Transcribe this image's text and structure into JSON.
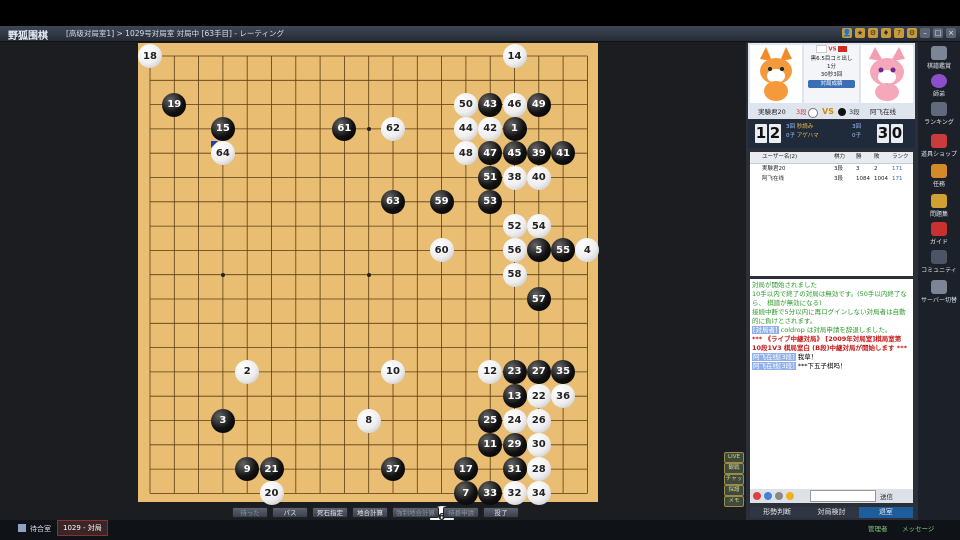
{
  "title": {
    "app": "野狐围棋",
    "breadcrumb": "[高级对局室1] > 1029号对局室  対局中 [63手目] - レーティング"
  },
  "title_icons": [
    "user-icon",
    "medal-icon",
    "gear-icon",
    "shirt-icon",
    "help-icon",
    "settings-icon",
    "minimize-icon",
    "maximize-icon",
    "close-icon"
  ],
  "board": {
    "size": 19,
    "last_move": 63,
    "black_stones": [
      {
        "col": 2,
        "row": 3,
        "n": "19"
      },
      {
        "col": 4,
        "row": 4,
        "n": "15"
      },
      {
        "col": 9,
        "row": 4,
        "n": "61"
      },
      {
        "col": 15,
        "row": 3,
        "n": "43"
      },
      {
        "col": 17,
        "row": 3,
        "n": "49"
      },
      {
        "col": 16,
        "row": 4,
        "n": "1"
      },
      {
        "col": 15,
        "row": 5,
        "n": "47"
      },
      {
        "col": 16,
        "row": 5,
        "n": "45"
      },
      {
        "col": 17,
        "row": 5,
        "n": "39"
      },
      {
        "col": 18,
        "row": 5,
        "n": "41"
      },
      {
        "col": 15,
        "row": 6,
        "n": "51"
      },
      {
        "col": 11,
        "row": 7,
        "n": "63"
      },
      {
        "col": 13,
        "row": 7,
        "n": "59"
      },
      {
        "col": 15,
        "row": 7,
        "n": "53"
      },
      {
        "col": 17,
        "row": 9,
        "n": "5"
      },
      {
        "col": 18,
        "row": 9,
        "n": "55"
      },
      {
        "col": 17,
        "row": 11,
        "n": "57"
      },
      {
        "col": 16,
        "row": 14,
        "n": "23"
      },
      {
        "col": 17,
        "row": 14,
        "n": "27"
      },
      {
        "col": 18,
        "row": 14,
        "n": "35"
      },
      {
        "col": 16,
        "row": 15,
        "n": "13"
      },
      {
        "col": 4,
        "row": 16,
        "n": "3"
      },
      {
        "col": 15,
        "row": 16,
        "n": "25"
      },
      {
        "col": 15,
        "row": 17,
        "n": "11"
      },
      {
        "col": 16,
        "row": 17,
        "n": "29"
      },
      {
        "col": 5,
        "row": 18,
        "n": "9"
      },
      {
        "col": 6,
        "row": 18,
        "n": "21"
      },
      {
        "col": 11,
        "row": 18,
        "n": "37"
      },
      {
        "col": 14,
        "row": 18,
        "n": "17"
      },
      {
        "col": 16,
        "row": 18,
        "n": "31"
      },
      {
        "col": 14,
        "row": 19,
        "n": "7"
      },
      {
        "col": 15,
        "row": 19,
        "n": "33"
      }
    ],
    "white_stones": [
      {
        "col": 1,
        "row": 1,
        "n": "18"
      },
      {
        "col": 16,
        "row": 1,
        "n": "14"
      },
      {
        "col": 14,
        "row": 3,
        "n": "50"
      },
      {
        "col": 16,
        "row": 3,
        "n": "46"
      },
      {
        "col": 11,
        "row": 4,
        "n": "62"
      },
      {
        "col": 14,
        "row": 4,
        "n": "44"
      },
      {
        "col": 15,
        "row": 4,
        "n": "42"
      },
      {
        "col": 4,
        "row": 5,
        "n": "64"
      },
      {
        "col": 14,
        "row": 5,
        "n": "48"
      },
      {
        "col": 16,
        "row": 6,
        "n": "38"
      },
      {
        "col": 17,
        "row": 6,
        "n": "40"
      },
      {
        "col": 16,
        "row": 8,
        "n": "52"
      },
      {
        "col": 17,
        "row": 8,
        "n": "54"
      },
      {
        "col": 13,
        "row": 9,
        "n": "60"
      },
      {
        "col": 16,
        "row": 9,
        "n": "56"
      },
      {
        "col": 19,
        "row": 9,
        "n": "4"
      },
      {
        "col": 16,
        "row": 10,
        "n": "58"
      },
      {
        "col": 5,
        "row": 14,
        "n": "2"
      },
      {
        "col": 11,
        "row": 14,
        "n": "10"
      },
      {
        "col": 15,
        "row": 14,
        "n": "12"
      },
      {
        "col": 17,
        "row": 15,
        "n": "22"
      },
      {
        "col": 18,
        "row": 15,
        "n": "36"
      },
      {
        "col": 10,
        "row": 16,
        "n": "8"
      },
      {
        "col": 16,
        "row": 16,
        "n": "24"
      },
      {
        "col": 17,
        "row": 16,
        "n": "26"
      },
      {
        "col": 17,
        "row": 17,
        "n": "30"
      },
      {
        "col": 17,
        "row": 18,
        "n": "28"
      },
      {
        "col": 6,
        "row": 19,
        "n": "20"
      },
      {
        "col": 16,
        "row": 19,
        "n": "32"
      },
      {
        "col": 17,
        "row": 19,
        "n": "34"
      },
      {
        "col": 13,
        "row": 20,
        "n": "6"
      }
    ]
  },
  "bottom_buttons": [
    {
      "label": "待った",
      "disabled": true
    },
    {
      "label": "パス",
      "disabled": false
    },
    {
      "label": "死石指定",
      "disabled": false
    },
    {
      "label": "地合計算",
      "disabled": false
    },
    {
      "label": "強制地合計算",
      "disabled": true
    },
    {
      "label": "持碁申請",
      "disabled": true
    },
    {
      "label": "投了",
      "disabled": false
    }
  ],
  "mini_buttons": [
    "LIVE",
    "観戦",
    "チャット",
    "採譜",
    "メモ"
  ],
  "players": {
    "black_name": "実験君20",
    "black_rank": "3段",
    "white_name": "阿飞在线",
    "white_rank": "3段",
    "vs": "VS",
    "rule_line1": "黒6.5目コミ出し",
    "rule_line2": "1分",
    "rule_line3": "30秒3回",
    "rule_line4": "対局成績"
  },
  "timer": {
    "black_digits": [
      "1",
      "2"
    ],
    "white_digits": [
      "3",
      "0"
    ],
    "black_byoyomi": "3回",
    "black_captures": "0子",
    "white_byoyomi": "3回",
    "white_captures": "0子",
    "label_byoyomi": "秒読み",
    "label_captures": "アゲハマ"
  },
  "users": {
    "headers": [
      "ユーザー名(2)",
      "棋力",
      "勝",
      "敗",
      "ランク"
    ],
    "rows": [
      {
        "name": "実験君20",
        "rank": "3段",
        "wins": "3",
        "losses": "2",
        "ranking": "171"
      },
      {
        "name": "阿飞在线",
        "rank": "3段",
        "wins": "1084",
        "losses": "1004",
        "ranking": "171"
      }
    ]
  },
  "chat": {
    "lines": [
      {
        "style": "sys",
        "text": "対局が開始されました"
      },
      {
        "style": "sys",
        "text": "10手以内で終了の対局は無効です。(50手以内終了なら、 棋譜が無効になる)"
      },
      {
        "style": "sys",
        "text": "接続中断で5分以内に再ログインしない対局者は自動的に負けとされます。"
      },
      {
        "style": "sys",
        "name": "[対局者]",
        "text": " coldrop は対局申請を辞退しました。"
      },
      {
        "style": "red",
        "text": "*** 《ライブ中継対局》 [2009年対局室]棋局室第 10段1V3 棋局室白 (B段)中継対局が開始します ***"
      },
      {
        "style": "normal",
        "name": "阿飞在线[3段]",
        "text": " 我草！"
      },
      {
        "style": "normal",
        "name": "阿飞在线[3段]",
        "text": " ***下五子棋吗！"
      }
    ],
    "send_label": "送信"
  },
  "tabs": [
    "形勢判断",
    "対局検討",
    "退室"
  ],
  "sidebar": [
    {
      "label": "棋譜鑑賞",
      "icon": "board-icon"
    },
    {
      "label": "師弟",
      "icon": "mentor-icon"
    },
    {
      "label": "ランキング",
      "icon": "ranking-icon"
    },
    {
      "label": "道具ショップ",
      "icon": "shop-icon"
    },
    {
      "label": "任務",
      "icon": "task-icon"
    },
    {
      "label": "問題集",
      "icon": "book-icon"
    },
    {
      "label": "ガイド",
      "icon": "guide-icon"
    },
    {
      "label": "コミュニティ",
      "icon": "community-icon"
    },
    {
      "label": "サーバー切替",
      "icon": "server-icon"
    }
  ],
  "status": {
    "room_label": "待合室",
    "game_tab": "1029 - 対局",
    "manager": "管理者",
    "messenger": "メッセージ"
  },
  "colors": {
    "board": "#e9bd72",
    "last_move_marker": "#1f3fb8",
    "accent": "#1e5c9c"
  }
}
